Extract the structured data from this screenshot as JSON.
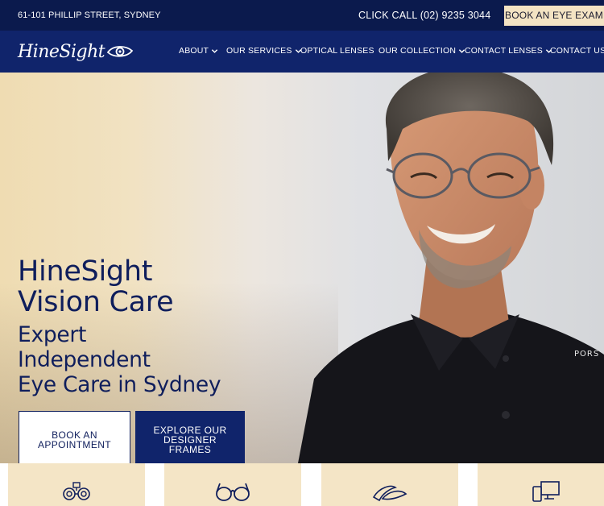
{
  "topbar": {
    "address": "61-101 PHILLIP STREET, SYDNEY",
    "call": "CLICK CALL (02) 9235 3044",
    "book_button": "BOOK AN EYE EXAM"
  },
  "navbar": {
    "logo_text": "HineSight",
    "items": [
      {
        "label": "ABOUT",
        "has_dropdown": true
      },
      {
        "label": "OUR SERVICES",
        "has_dropdown": true
      },
      {
        "label": "OPTICAL LENSES",
        "has_dropdown": false
      },
      {
        "label": "OUR COLLECTION",
        "has_dropdown": true
      },
      {
        "label": "CONTACT LENSES",
        "has_dropdown": true
      },
      {
        "label": "CONTACT US",
        "has_dropdown": false
      }
    ]
  },
  "hero": {
    "title_line1": "HineSight",
    "title_line2": "Vision Care",
    "subtitle_line1": "Expert",
    "subtitle_line2": "Independent",
    "subtitle_line3": "Eye Care in Sydney",
    "cta_primary": "BOOK AN APPOINTMENT",
    "cta_secondary": "EXPLORE OUR DESIGNER FRAMES",
    "shirt_text": "PORS"
  },
  "cards": [
    {
      "icon": "phoropter-icon"
    },
    {
      "icon": "glasses-icon"
    },
    {
      "icon": "contact-lens-icon"
    },
    {
      "icon": "devices-icon"
    }
  ],
  "colors": {
    "topbar_bg": "#0b1a4d",
    "navbar_bg": "#10246b",
    "accent_cream": "#f3e3c3",
    "heading_navy": "#0f1e5c"
  }
}
